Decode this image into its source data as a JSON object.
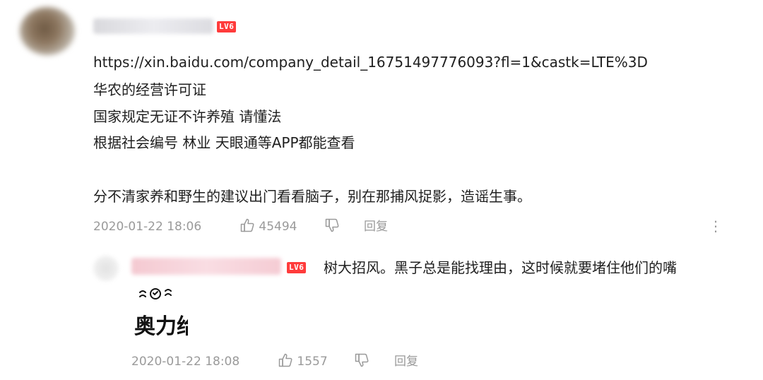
{
  "comment": {
    "level_badge": "LV6",
    "lines": [
      "https://xin.baidu.com/company_detail_16751497776093?fl=1&castk=LTE%3D",
      "华农的经营许可证",
      "国家规定无证不许养殖 请懂法",
      "根据社会编号 林业 天眼通等APP都能查看",
      "分不清家养和野生的建议出门看看脑子，别在那捕风捉影，造谣生事。"
    ],
    "timestamp": "2020-01-22 18:06",
    "likes": "45494",
    "reply_label": "回复",
    "more_label": "⋮"
  },
  "reply": {
    "level_badge": "LV6",
    "text": "树大招风。黑子总是能找理由，这时候就要堵住他们的嘴",
    "sticker_text": "奥力给",
    "timestamp": "2020-01-22 18:08",
    "likes": "1557",
    "reply_label": "回复"
  }
}
